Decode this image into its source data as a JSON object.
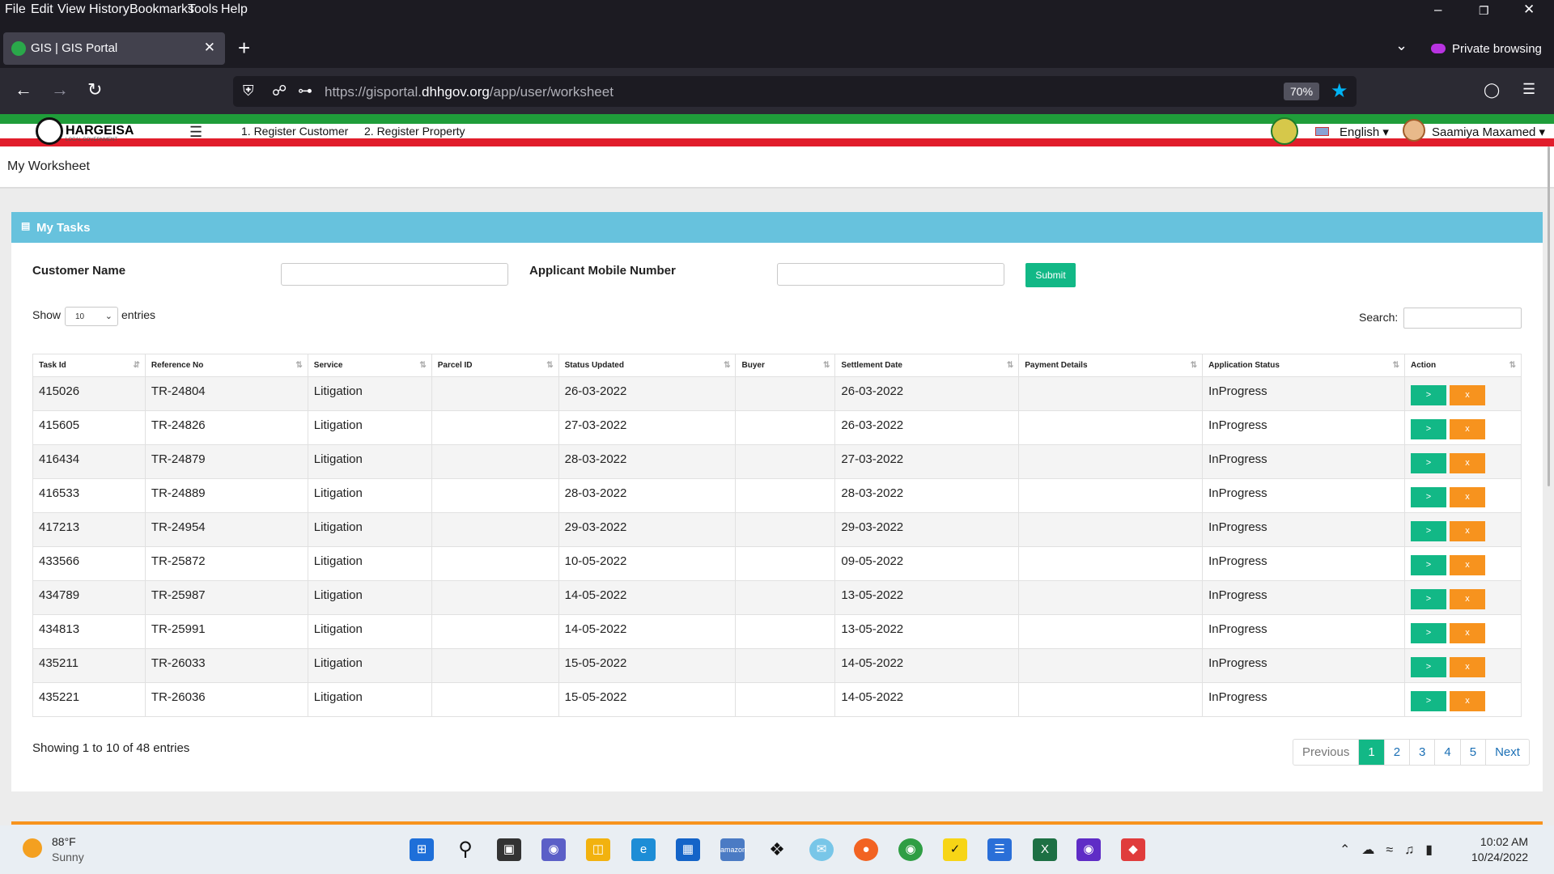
{
  "browser": {
    "menu": [
      "File",
      "Edit",
      "View",
      "History",
      "Bookmarks",
      "Tools",
      "Help"
    ],
    "tab_title": "GIS | GIS Portal",
    "private_label": "Private browsing",
    "url_prefix": "https://gisportal.",
    "url_domain": "dhhgov.org",
    "url_path": "/app/user/worksheet",
    "zoom": "70%"
  },
  "site": {
    "logo_text": "HARGEISA",
    "logo_sub": "LOCAL GOVERNMENT",
    "links": [
      "1. Register Customer",
      "2. Register Property"
    ],
    "language": "English ▾",
    "user": "Saamiya Maxamed ▾",
    "page_title": "My Worksheet"
  },
  "card": {
    "title": "My Tasks",
    "customer_label": "Customer Name",
    "mobile_label": "Applicant Mobile Number",
    "submit": "Submit",
    "show": "Show",
    "entries": "entries",
    "length_value": "10",
    "search_label": "Search:",
    "columns": [
      "Task Id",
      "Reference No",
      "Service",
      "Parcel ID",
      "Status Updated",
      "Buyer",
      "Settlement Date",
      "Payment Details",
      "Application Status",
      "Action"
    ],
    "rows": [
      [
        "415026",
        "TR-24804",
        "Litigation",
        "",
        "26-03-2022",
        "",
        "26-03-2022",
        "",
        "InProgress"
      ],
      [
        "415605",
        "TR-24826",
        "Litigation",
        "",
        "27-03-2022",
        "",
        "26-03-2022",
        "",
        "InProgress"
      ],
      [
        "416434",
        "TR-24879",
        "Litigation",
        "",
        "28-03-2022",
        "",
        "27-03-2022",
        "",
        "InProgress"
      ],
      [
        "416533",
        "TR-24889",
        "Litigation",
        "",
        "28-03-2022",
        "",
        "28-03-2022",
        "",
        "InProgress"
      ],
      [
        "417213",
        "TR-24954",
        "Litigation",
        "",
        "29-03-2022",
        "",
        "29-03-2022",
        "",
        "InProgress"
      ],
      [
        "433566",
        "TR-25872",
        "Litigation",
        "",
        "10-05-2022",
        "",
        "09-05-2022",
        "",
        "InProgress"
      ],
      [
        "434789",
        "TR-25987",
        "Litigation",
        "",
        "14-05-2022",
        "",
        "13-05-2022",
        "",
        "InProgress"
      ],
      [
        "434813",
        "TR-25991",
        "Litigation",
        "",
        "14-05-2022",
        "",
        "13-05-2022",
        "",
        "InProgress"
      ],
      [
        "435211",
        "TR-26033",
        "Litigation",
        "",
        "15-05-2022",
        "",
        "14-05-2022",
        "",
        "InProgress"
      ],
      [
        "435221",
        "TR-26036",
        "Litigation",
        "",
        "15-05-2022",
        "",
        "14-05-2022",
        "",
        "InProgress"
      ]
    ],
    "action_go": ">",
    "action_remove": "x",
    "info": "Showing 1 to 10 of 48 entries",
    "pager": [
      "Previous",
      "1",
      "2",
      "3",
      "4",
      "5",
      "Next"
    ],
    "active_page": "1"
  },
  "taskbar": {
    "temp": "88°F",
    "weather": "Sunny",
    "time": "10:02 AM",
    "date": "10/24/2022"
  },
  "colors": {
    "accent": "#12b886",
    "header": "#67c2dd",
    "remove": "#f7931e"
  }
}
